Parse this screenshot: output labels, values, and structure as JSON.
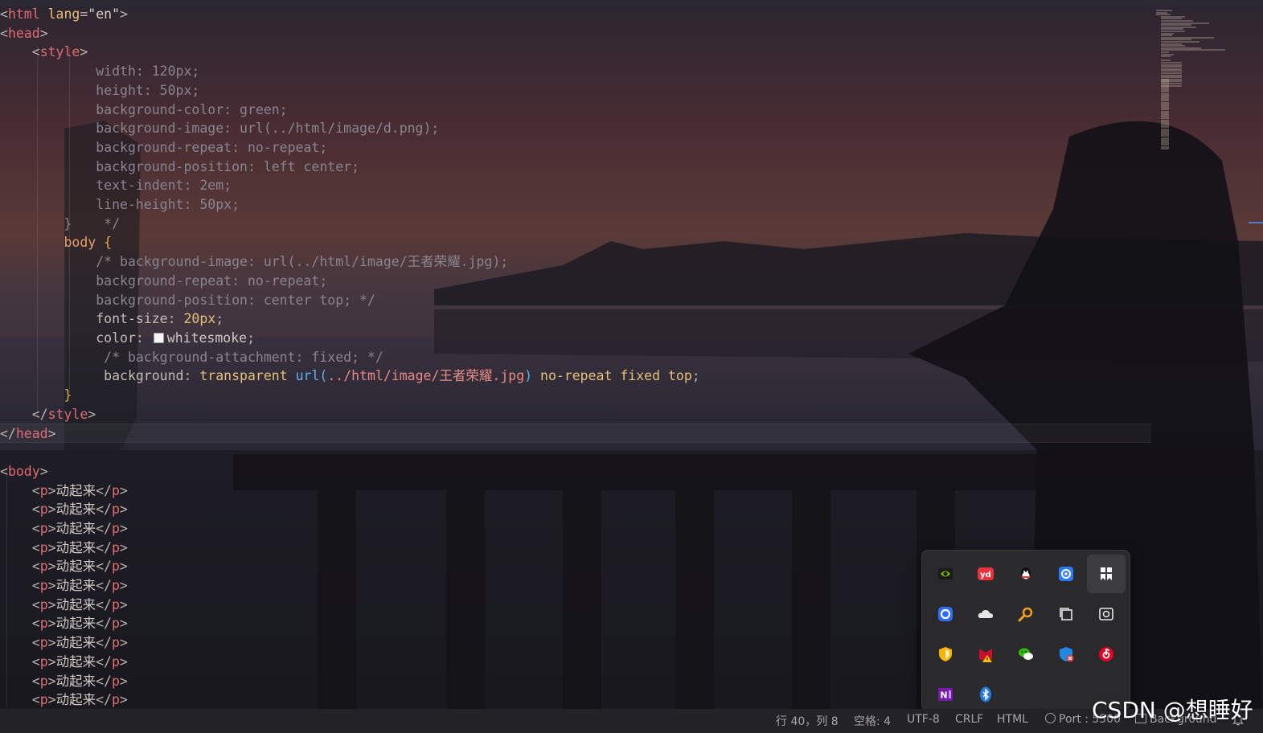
{
  "code_lines": [
    {
      "parts": [
        {
          "c": "t-br",
          "t": "<"
        },
        {
          "c": "t-tag",
          "t": "html"
        },
        {
          "c": "t-attr",
          "t": " lang"
        },
        {
          "c": "t-br",
          "t": "="
        },
        {
          "c": "t-str",
          "t": "\"en\""
        },
        {
          "c": "t-br",
          "t": ">"
        }
      ]
    },
    {
      "parts": [
        {
          "c": "t-br",
          "t": "<"
        },
        {
          "c": "t-tag",
          "t": "head"
        },
        {
          "c": "t-br",
          "t": ">"
        }
      ]
    },
    {
      "parts": [
        {
          "c": "",
          "t": "    "
        },
        {
          "c": "t-br",
          "t": "<"
        },
        {
          "c": "t-tag",
          "t": "style"
        },
        {
          "c": "t-br",
          "t": ">"
        }
      ]
    },
    {
      "parts": [
        {
          "c": "t-cm",
          "t": "            width: 120px;"
        }
      ]
    },
    {
      "parts": [
        {
          "c": "t-cm",
          "t": "            height: 50px;"
        }
      ]
    },
    {
      "parts": [
        {
          "c": "t-cm",
          "t": "            background-color: green;"
        }
      ]
    },
    {
      "parts": [
        {
          "c": "t-cm",
          "t": "            background-image: url(../html/image/d.png);"
        }
      ]
    },
    {
      "parts": [
        {
          "c": "t-cm",
          "t": "            background-repeat: no-repeat;"
        }
      ]
    },
    {
      "parts": [
        {
          "c": "t-cm",
          "t": "            background-position: left center;"
        }
      ]
    },
    {
      "parts": [
        {
          "c": "t-cm",
          "t": "            text-indent: 2em;"
        }
      ]
    },
    {
      "parts": [
        {
          "c": "t-cm",
          "t": "            line-height: 50px;"
        }
      ]
    },
    {
      "parts": [
        {
          "c": "t-cm",
          "t": "        }    */"
        }
      ]
    },
    {
      "parts": [
        {
          "c": "t-sel",
          "t": "        body "
        },
        {
          "c": "t-brace",
          "t": "{"
        }
      ]
    },
    {
      "parts": [
        {
          "c": "t-cm",
          "t": "            /* background-image: url(../html/image/王者荣耀.jpg);"
        }
      ]
    },
    {
      "parts": [
        {
          "c": "t-cm",
          "t": "            background-repeat: no-repeat;"
        }
      ]
    },
    {
      "parts": [
        {
          "c": "t-cm",
          "t": "            background-position: center top; */"
        }
      ]
    },
    {
      "parts": [
        {
          "c": "t-prop",
          "t": "            font-size"
        },
        {
          "c": "t-br",
          "t": ": "
        },
        {
          "c": "t-num",
          "t": "20px"
        },
        {
          "c": "t-br",
          "t": ";"
        }
      ]
    },
    {
      "parts": [
        {
          "c": "t-prop",
          "t": "            color"
        },
        {
          "c": "t-br",
          "t": ": "
        },
        {
          "c": "swatch",
          "t": ""
        },
        {
          "c": "t-val",
          "t": "whitesmoke"
        },
        {
          "c": "t-br",
          "t": ";"
        }
      ]
    },
    {
      "parts": [
        {
          "c": "t-cm",
          "t": "             /* background-attachment: fixed; */"
        }
      ]
    },
    {
      "parts": [
        {
          "c": "t-prop",
          "t": "             background"
        },
        {
          "c": "t-br",
          "t": ": "
        },
        {
          "c": "t-kw",
          "t": "transparent "
        },
        {
          "c": "t-url",
          "t": "url("
        },
        {
          "c": "t-red",
          "t": "../html/image/王者荣耀.jpg"
        },
        {
          "c": "t-url",
          "t": ")"
        },
        {
          "c": "t-kw",
          "t": " no-repeat fixed top"
        },
        {
          "c": "t-br",
          "t": ";"
        }
      ]
    },
    {
      "parts": [
        {
          "c": "t-brace",
          "t": "        }"
        }
      ]
    },
    {
      "parts": [
        {
          "c": "",
          "t": "    "
        },
        {
          "c": "t-br",
          "t": "</"
        },
        {
          "c": "t-tag",
          "t": "style"
        },
        {
          "c": "t-br",
          "t": ">"
        }
      ]
    },
    {
      "parts": [
        {
          "c": "t-br",
          "t": "</"
        },
        {
          "c": "t-tag",
          "t": "head"
        },
        {
          "c": "t-br",
          "t": ">"
        }
      ],
      "current": true
    },
    {
      "parts": []
    },
    {
      "parts": [
        {
          "c": "t-br",
          "t": "<"
        },
        {
          "c": "t-tag",
          "t": "body"
        },
        {
          "c": "t-br",
          "t": ">"
        }
      ]
    },
    {
      "parts": [
        {
          "c": "",
          "t": "    "
        },
        {
          "c": "t-br",
          "t": "<"
        },
        {
          "c": "t-tag",
          "t": "p"
        },
        {
          "c": "t-br",
          "t": ">"
        },
        {
          "c": "t-val",
          "t": "动起来"
        },
        {
          "c": "t-br",
          "t": "</"
        },
        {
          "c": "t-tag",
          "t": "p"
        },
        {
          "c": "t-br",
          "t": ">"
        }
      ]
    },
    {
      "parts": [
        {
          "c": "",
          "t": "    "
        },
        {
          "c": "t-br",
          "t": "<"
        },
        {
          "c": "t-tag",
          "t": "p"
        },
        {
          "c": "t-br",
          "t": ">"
        },
        {
          "c": "t-val",
          "t": "动起来"
        },
        {
          "c": "t-br",
          "t": "</"
        },
        {
          "c": "t-tag",
          "t": "p"
        },
        {
          "c": "t-br",
          "t": ">"
        }
      ]
    },
    {
      "parts": [
        {
          "c": "",
          "t": "    "
        },
        {
          "c": "t-br",
          "t": "<"
        },
        {
          "c": "t-tag",
          "t": "p"
        },
        {
          "c": "t-br",
          "t": ">"
        },
        {
          "c": "t-val",
          "t": "动起来"
        },
        {
          "c": "t-br",
          "t": "</"
        },
        {
          "c": "t-tag",
          "t": "p"
        },
        {
          "c": "t-br",
          "t": ">"
        }
      ]
    },
    {
      "parts": [
        {
          "c": "",
          "t": "    "
        },
        {
          "c": "t-br",
          "t": "<"
        },
        {
          "c": "t-tag",
          "t": "p"
        },
        {
          "c": "t-br",
          "t": ">"
        },
        {
          "c": "t-val",
          "t": "动起来"
        },
        {
          "c": "t-br",
          "t": "</"
        },
        {
          "c": "t-tag",
          "t": "p"
        },
        {
          "c": "t-br",
          "t": ">"
        }
      ]
    },
    {
      "parts": [
        {
          "c": "",
          "t": "    "
        },
        {
          "c": "t-br",
          "t": "<"
        },
        {
          "c": "t-tag",
          "t": "p"
        },
        {
          "c": "t-br",
          "t": ">"
        },
        {
          "c": "t-val",
          "t": "动起来"
        },
        {
          "c": "t-br",
          "t": "</"
        },
        {
          "c": "t-tag",
          "t": "p"
        },
        {
          "c": "t-br",
          "t": ">"
        }
      ]
    },
    {
      "parts": [
        {
          "c": "",
          "t": "    "
        },
        {
          "c": "t-br",
          "t": "<"
        },
        {
          "c": "t-tag",
          "t": "p"
        },
        {
          "c": "t-br",
          "t": ">"
        },
        {
          "c": "t-val",
          "t": "动起来"
        },
        {
          "c": "t-br",
          "t": "</"
        },
        {
          "c": "t-tag",
          "t": "p"
        },
        {
          "c": "t-br",
          "t": ">"
        }
      ]
    },
    {
      "parts": [
        {
          "c": "",
          "t": "    "
        },
        {
          "c": "t-br",
          "t": "<"
        },
        {
          "c": "t-tag",
          "t": "p"
        },
        {
          "c": "t-br",
          "t": ">"
        },
        {
          "c": "t-val",
          "t": "动起来"
        },
        {
          "c": "t-br",
          "t": "</"
        },
        {
          "c": "t-tag",
          "t": "p"
        },
        {
          "c": "t-br",
          "t": ">"
        }
      ]
    },
    {
      "parts": [
        {
          "c": "",
          "t": "    "
        },
        {
          "c": "t-br",
          "t": "<"
        },
        {
          "c": "t-tag",
          "t": "p"
        },
        {
          "c": "t-br",
          "t": ">"
        },
        {
          "c": "t-val",
          "t": "动起来"
        },
        {
          "c": "t-br",
          "t": "</"
        },
        {
          "c": "t-tag",
          "t": "p"
        },
        {
          "c": "t-br",
          "t": ">"
        }
      ]
    },
    {
      "parts": [
        {
          "c": "",
          "t": "    "
        },
        {
          "c": "t-br",
          "t": "<"
        },
        {
          "c": "t-tag",
          "t": "p"
        },
        {
          "c": "t-br",
          "t": ">"
        },
        {
          "c": "t-val",
          "t": "动起来"
        },
        {
          "c": "t-br",
          "t": "</"
        },
        {
          "c": "t-tag",
          "t": "p"
        },
        {
          "c": "t-br",
          "t": ">"
        }
      ]
    },
    {
      "parts": [
        {
          "c": "",
          "t": "    "
        },
        {
          "c": "t-br",
          "t": "<"
        },
        {
          "c": "t-tag",
          "t": "p"
        },
        {
          "c": "t-br",
          "t": ">"
        },
        {
          "c": "t-val",
          "t": "动起来"
        },
        {
          "c": "t-br",
          "t": "</"
        },
        {
          "c": "t-tag",
          "t": "p"
        },
        {
          "c": "t-br",
          "t": ">"
        }
      ]
    },
    {
      "parts": [
        {
          "c": "",
          "t": "    "
        },
        {
          "c": "t-br",
          "t": "<"
        },
        {
          "c": "t-tag",
          "t": "p"
        },
        {
          "c": "t-br",
          "t": ">"
        },
        {
          "c": "t-val",
          "t": "动起来"
        },
        {
          "c": "t-br",
          "t": "</"
        },
        {
          "c": "t-tag",
          "t": "p"
        },
        {
          "c": "t-br",
          "t": ">"
        }
      ]
    },
    {
      "parts": [
        {
          "c": "",
          "t": "    "
        },
        {
          "c": "t-br",
          "t": "<"
        },
        {
          "c": "t-tag",
          "t": "p"
        },
        {
          "c": "t-br",
          "t": ">"
        },
        {
          "c": "t-val",
          "t": "动起来"
        },
        {
          "c": "t-br",
          "t": "</"
        },
        {
          "c": "t-tag",
          "t": "p"
        },
        {
          "c": "t-br",
          "t": ">"
        }
      ]
    }
  ],
  "tray": {
    "icons": [
      {
        "name": "nvidia-icon",
        "color": "#76b900"
      },
      {
        "name": "youdao-icon",
        "color": "#e8323c"
      },
      {
        "name": "qq-icon",
        "color": "#ffffff"
      },
      {
        "name": "settings-gear-app-icon",
        "color": "#2d7cf6"
      },
      {
        "name": "bookmark-app-icon",
        "color": "#ffffff"
      },
      {
        "name": "browser-circle-icon",
        "color": "#2f6bff"
      },
      {
        "name": "onedrive-cloud-icon",
        "color": "#e6e6e6"
      },
      {
        "name": "search-key-icon",
        "color": "#f0a020"
      },
      {
        "name": "copy-windows-icon",
        "color": "#e6e6e6"
      },
      {
        "name": "screenshot-capture-icon",
        "color": "#e6e6e6"
      },
      {
        "name": "security-shield-icon",
        "color": "#f5b400"
      },
      {
        "name": "mcafee-warning-icon",
        "color": "#c8102e"
      },
      {
        "name": "wechat-icon",
        "color": "#2dc100"
      },
      {
        "name": "defender-shield-icon",
        "color": "#1e88e5"
      },
      {
        "name": "netease-music-icon",
        "color": "#e60026"
      },
      {
        "name": "onenote-icon",
        "color": "#7719aa"
      },
      {
        "name": "bluetooth-icon",
        "color": "#1f7ae0"
      }
    ]
  },
  "status": {
    "position": "行 40，列 8",
    "spaces": "空格: 4",
    "encoding": "UTF-8",
    "eol": "CRLF",
    "language": "HTML",
    "port": "Port : 5500",
    "background": "Background"
  },
  "watermark": "CSDN @想睡好"
}
